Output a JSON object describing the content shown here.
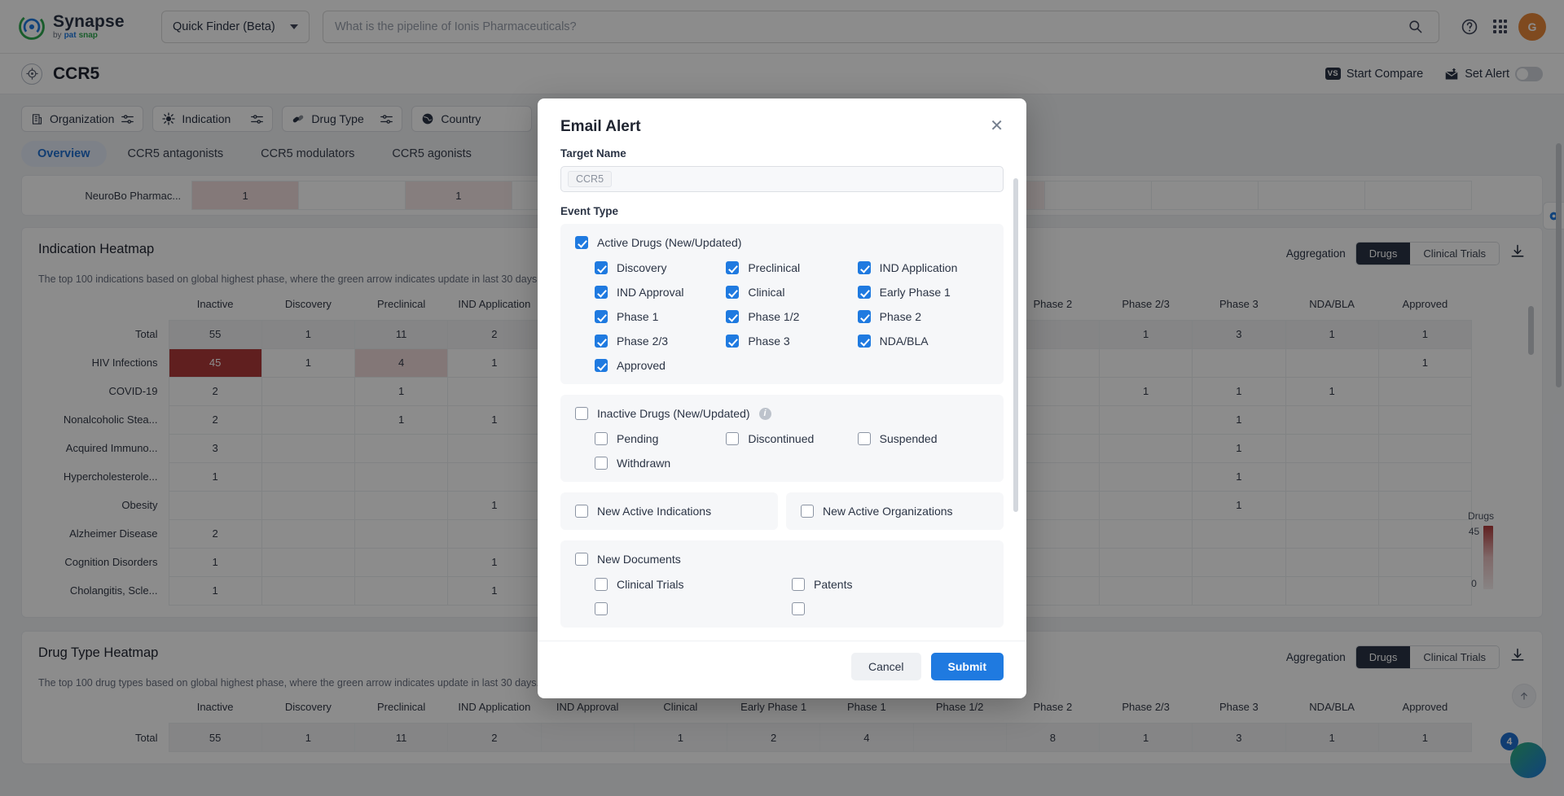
{
  "topnav": {
    "brand_title": "Synapse",
    "brand_by": "by",
    "brand_pat": "pat",
    "brand_snap": "snap",
    "finder_label": "Quick Finder (Beta)",
    "search_placeholder": "What is the pipeline of Ionis Pharmaceuticals?",
    "avatar_initial": "G",
    "icons": {
      "search": "search-icon",
      "help": "help-icon",
      "apps": "apps-grid-icon"
    }
  },
  "pagehead": {
    "title": "CCR5",
    "start_compare": "Start Compare",
    "vs_badge": "VS",
    "set_alert": "Set Alert"
  },
  "filters": [
    {
      "label": "Organization",
      "icon": "organization-icon"
    },
    {
      "label": "Indication",
      "icon": "indication-icon"
    },
    {
      "label": "Drug Type",
      "icon": "drug-type-icon"
    },
    {
      "label": "Country",
      "icon": "country-globe-icon"
    }
  ],
  "tabs": [
    {
      "label": "Overview",
      "active": true
    },
    {
      "label": "CCR5 antagonists",
      "active": false
    },
    {
      "label": "CCR5 modulators",
      "active": false
    },
    {
      "label": "CCR5 agonists",
      "active": false
    }
  ],
  "top_table": {
    "row_label": "NeuroBo Pharmac...",
    "values": [
      "1",
      "",
      "1",
      "",
      "",
      "",
      "",
      "",
      "",
      "",
      "",
      ""
    ]
  },
  "indication_card": {
    "title": "Indication Heatmap",
    "subtitle": "The top 100 indications based on global highest phase, where the green arrow indicates update in last 30 days.",
    "aggregation_label": "Aggregation",
    "seg_drugs": "Drugs",
    "seg_trials": "Clinical Trials",
    "download_icon": "download-icon",
    "legend": {
      "title": "Drugs",
      "max": "45",
      "min": "0"
    }
  },
  "drugtype_card": {
    "title": "Drug Type Heatmap",
    "subtitle": "The top 100 drug types based on global highest phase, where the green arrow indicates update in last 30 days.",
    "aggregation_label": "Aggregation",
    "seg_drugs": "Drugs",
    "seg_trials": "Clinical Trials",
    "download_icon": "download-icon"
  },
  "chart_data": {
    "type": "heatmap",
    "title": "Indication Heatmap",
    "columns": [
      "Inactive",
      "Discovery",
      "Preclinical",
      "IND Application",
      "IND Approval",
      "Clinical",
      "Early Phase 1",
      "Phase 1",
      "Phase 1/2",
      "Phase 2",
      "Phase 2/3",
      "Phase 3",
      "NDA/BLA",
      "Approved"
    ],
    "rows": [
      {
        "label": "Total",
        "values": [
          "55",
          "1",
          "11",
          "2",
          "",
          "",
          "",
          "",
          "",
          "",
          "1",
          "3",
          "1",
          "1"
        ]
      },
      {
        "label": "HIV Infections",
        "values": [
          "45",
          "1",
          "4",
          "1",
          "",
          "",
          "",
          "",
          "",
          "",
          "",
          "",
          "",
          "1"
        ]
      },
      {
        "label": "COVID-19",
        "values": [
          "2",
          "",
          "1",
          "",
          "",
          "",
          "",
          "",
          "",
          "",
          "1",
          "1",
          "1",
          ""
        ]
      },
      {
        "label": "Nonalcoholic Stea...",
        "values": [
          "2",
          "",
          "1",
          "1",
          "",
          "",
          "",
          "",
          "",
          "",
          "",
          "1",
          "",
          ""
        ]
      },
      {
        "label": "Acquired Immuno...",
        "values": [
          "3",
          "",
          "",
          "",
          "",
          "",
          "",
          "",
          "",
          "",
          "",
          "1",
          "",
          ""
        ]
      },
      {
        "label": "Hypercholesterole...",
        "values": [
          "1",
          "",
          "",
          "",
          "",
          "",
          "",
          "",
          "",
          "",
          "",
          "1",
          "",
          ""
        ]
      },
      {
        "label": "Obesity",
        "values": [
          "",
          "",
          "",
          "1",
          "",
          "",
          "",
          "",
          "",
          "",
          "",
          "1",
          "",
          ""
        ]
      },
      {
        "label": "Alzheimer Disease",
        "values": [
          "2",
          "",
          "",
          "",
          "",
          "",
          "",
          "",
          "",
          "",
          "",
          "",
          "",
          ""
        ]
      },
      {
        "label": "Cognition Disorders",
        "values": [
          "1",
          "",
          "",
          "1",
          "",
          "",
          "",
          "",
          "",
          "",
          "",
          "",
          "",
          ""
        ]
      },
      {
        "label": "Cholangitis, Scle...",
        "values": [
          "1",
          "",
          "",
          "1",
          "",
          "",
          "",
          "",
          "",
          "",
          "",
          "",
          "",
          ""
        ]
      }
    ],
    "highlight": {
      "row": "HIV Infections",
      "column": "Inactive",
      "value": "45",
      "color": "#b03a3a"
    },
    "colorscale": {
      "label": "Drugs",
      "min": 0,
      "max": 45,
      "low_color": "#f7f0f0",
      "high_color": "#b03a3a"
    }
  },
  "drugtype_chart": {
    "type": "heatmap",
    "title": "Drug Type Heatmap",
    "columns": [
      "Inactive",
      "Discovery",
      "Preclinical",
      "IND Application",
      "IND Approval",
      "Clinical",
      "Early Phase 1",
      "Phase 1",
      "Phase 1/2",
      "Phase 2",
      "Phase 2/3",
      "Phase 3",
      "NDA/BLA",
      "Approved"
    ],
    "rows": [
      {
        "label": "Total",
        "values": [
          "55",
          "1",
          "11",
          "2",
          "",
          "1",
          "2",
          "4",
          "",
          "8",
          "1",
          "3",
          "1",
          "1"
        ]
      }
    ]
  },
  "modal": {
    "title": "Email Alert",
    "close_icon": "close-icon",
    "target_name_label": "Target Name",
    "target_name_value": "CCR5",
    "event_type_label": "Event Type",
    "groups": [
      {
        "id": "active-drugs",
        "parent": {
          "label": "Active Drugs (New/Updated)",
          "checked": true
        },
        "children": [
          {
            "label": "Discovery",
            "checked": true
          },
          {
            "label": "Preclinical",
            "checked": true
          },
          {
            "label": "IND Application",
            "checked": true
          },
          {
            "label": "IND Approval",
            "checked": true
          },
          {
            "label": "Clinical",
            "checked": true
          },
          {
            "label": "Early Phase 1",
            "checked": true
          },
          {
            "label": "Phase 1",
            "checked": true
          },
          {
            "label": "Phase 1/2",
            "checked": true
          },
          {
            "label": "Phase 2",
            "checked": true
          },
          {
            "label": "Phase 2/3",
            "checked": true
          },
          {
            "label": "Phase 3",
            "checked": true
          },
          {
            "label": "NDA/BLA",
            "checked": true
          },
          {
            "label": "Approved",
            "checked": true
          }
        ]
      },
      {
        "id": "inactive-drugs",
        "parent": {
          "label": "Inactive Drugs (New/Updated)",
          "checked": false,
          "info": true
        },
        "children": [
          {
            "label": "Pending",
            "checked": false
          },
          {
            "label": "Discontinued",
            "checked": false
          },
          {
            "label": "Suspended",
            "checked": false
          },
          {
            "label": "Withdrawn",
            "checked": false
          }
        ]
      }
    ],
    "standalone": [
      {
        "label": "New Active Indications",
        "checked": false
      },
      {
        "label": "New Active Organizations",
        "checked": false
      }
    ],
    "documents": {
      "parent": {
        "label": "New Documents",
        "checked": false
      },
      "children": [
        {
          "label": "Clinical Trials",
          "checked": false
        },
        {
          "label": "Patents",
          "checked": false
        }
      ]
    },
    "cancel_label": "Cancel",
    "submit_label": "Submit"
  },
  "floating": {
    "chat_badge": "4",
    "back_to_top_icon": "arrow-up-icon"
  },
  "colors": {
    "accent": "#1f7ae0",
    "dark": "#2b3445",
    "heat_high": "#b03a3a"
  }
}
